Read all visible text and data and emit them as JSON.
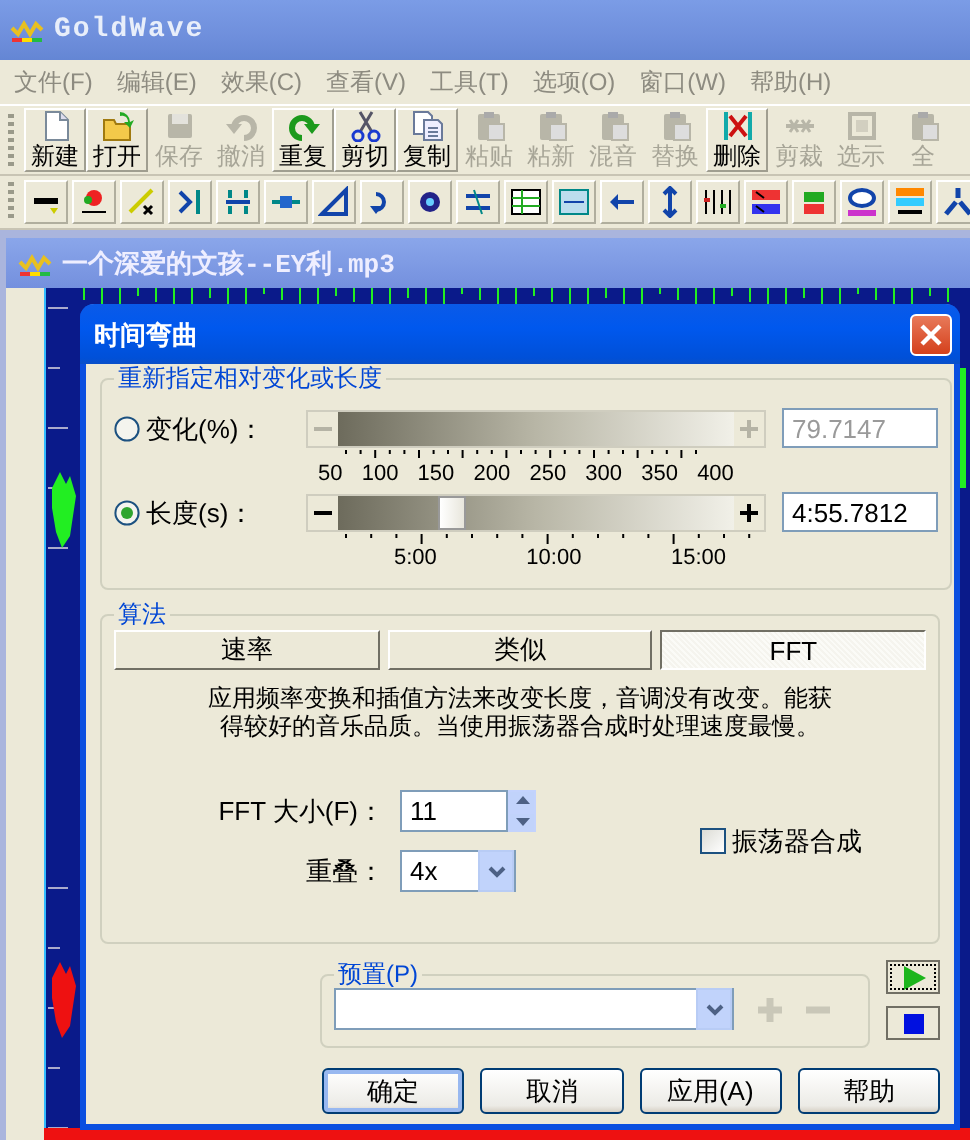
{
  "window": {
    "title": "GoldWave"
  },
  "menu": [
    {
      "label": "文件(F)",
      "disabled": true
    },
    {
      "label": "编辑(E)",
      "disabled": true
    },
    {
      "label": "效果(C)",
      "disabled": true
    },
    {
      "label": "查看(V)",
      "disabled": true
    },
    {
      "label": "工具(T)",
      "disabled": true
    },
    {
      "label": "选项(O)",
      "disabled": true
    },
    {
      "label": "窗口(W)",
      "disabled": true
    },
    {
      "label": "帮助(H)",
      "disabled": true
    }
  ],
  "toolbar": [
    {
      "label": "新建",
      "kind": "new",
      "disabled": false
    },
    {
      "label": "打开",
      "kind": "open",
      "disabled": false
    },
    {
      "label": "保存",
      "kind": "save",
      "disabled": true
    },
    {
      "label": "撤消",
      "kind": "undo",
      "disabled": true
    },
    {
      "label": "重复",
      "kind": "redo",
      "disabled": false
    },
    {
      "label": "剪切",
      "kind": "cut",
      "disabled": false
    },
    {
      "label": "复制",
      "kind": "copy",
      "disabled": false
    },
    {
      "label": "粘贴",
      "kind": "paste",
      "disabled": true
    },
    {
      "label": "粘新",
      "kind": "paste",
      "disabled": true
    },
    {
      "label": "混音",
      "kind": "paste",
      "disabled": true
    },
    {
      "label": "替换",
      "kind": "paste",
      "disabled": true
    },
    {
      "label": "删除",
      "kind": "delete",
      "disabled": false
    },
    {
      "label": "剪裁",
      "kind": "trim",
      "disabled": true
    },
    {
      "label": "选示",
      "kind": "frame",
      "disabled": true
    },
    {
      "label": "全",
      "kind": "paste",
      "disabled": true
    }
  ],
  "document": {
    "title": "一个深爱的文孩--EY利.mp3"
  },
  "dialog": {
    "title": "时间弯曲",
    "resize_group": {
      "title": "重新指定相对变化或长度",
      "options": [
        {
          "label": "变化(%)：",
          "selected": false,
          "disabled": true,
          "ticks": [
            "50",
            "100",
            "150",
            "200",
            "250",
            "300",
            "350",
            "400"
          ],
          "value": "79.7147"
        },
        {
          "label": "长度(s)：",
          "selected": true,
          "disabled": false,
          "level": 0.285,
          "ticks": [
            "5:00",
            "10:00",
            "15:00"
          ],
          "value": "4:55.7812"
        }
      ]
    },
    "algorithm": {
      "title": "算法",
      "methods": [
        {
          "label": "速率",
          "selected": false
        },
        {
          "label": "类似",
          "selected": false
        },
        {
          "label": "FFT",
          "selected": true
        }
      ],
      "description": "应用频率变换和插值方法来改变长度，音调没有改变。能获得较好的音乐品质。当使用振荡器合成时处理速度最慢。",
      "fft_size": {
        "label": "FFT 大小(F)：",
        "value": "11"
      },
      "overlap": {
        "label": "重叠：",
        "value": "4x"
      },
      "oscillator": {
        "label": "振荡器合成",
        "checked": false
      }
    },
    "preset": {
      "title": "预置(P)",
      "add_disabled": true,
      "remove_disabled": true
    },
    "buttons": [
      {
        "label": "确定",
        "default": true
      },
      {
        "label": "取消",
        "default": false
      },
      {
        "label": "应用(A)",
        "default": false
      },
      {
        "label": "帮助",
        "default": false
      }
    ]
  }
}
